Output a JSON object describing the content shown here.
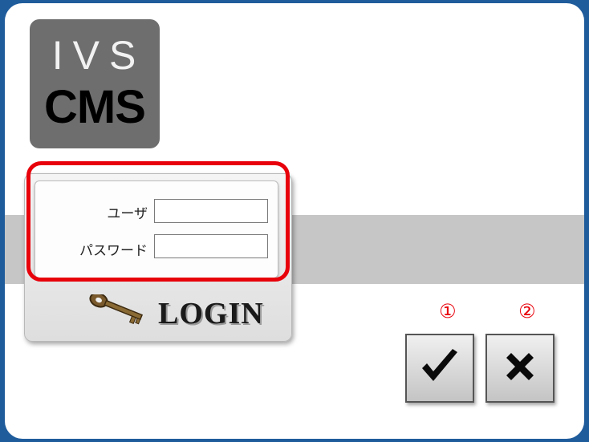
{
  "logo": {
    "line1": "IVS",
    "line2": "CMS"
  },
  "form": {
    "user_label": "ユーザ",
    "password_label": "パスワード",
    "user_value": "",
    "password_value": ""
  },
  "login": {
    "label": "LOGIN",
    "icon": "key-icon"
  },
  "actions": {
    "ok": {
      "number": "①",
      "icon": "checkmark-icon"
    },
    "cancel": {
      "number": "②",
      "icon": "close-icon"
    }
  },
  "colors": {
    "highlight": "#e8000a",
    "logo_bg": "#6e6e6e",
    "band": "#c6c6c6",
    "frame": "#1f5c9c"
  }
}
